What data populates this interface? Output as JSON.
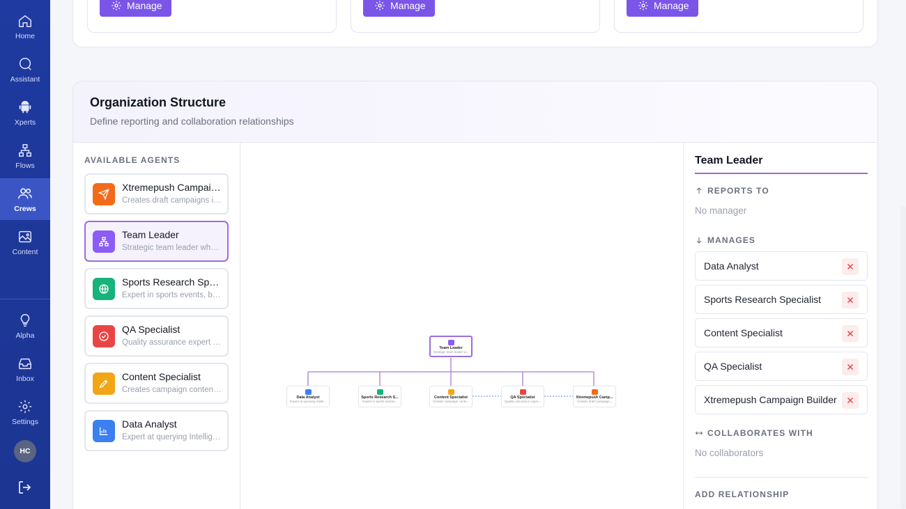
{
  "sidebar": {
    "items": [
      {
        "label": "Home",
        "icon": "home-icon"
      },
      {
        "label": "Assistant",
        "icon": "chat-icon"
      },
      {
        "label": "Xperts",
        "icon": "android-icon"
      },
      {
        "label": "Flows",
        "icon": "flow-icon"
      },
      {
        "label": "Crews",
        "icon": "users-icon",
        "active": true
      },
      {
        "label": "Content",
        "icon": "image-icon"
      }
    ],
    "bottom_items": [
      {
        "label": "Alpha",
        "icon": "lightbulb-icon"
      },
      {
        "label": "Inbox",
        "icon": "inbox-icon"
      },
      {
        "label": "Settings",
        "icon": "gear-icon"
      }
    ],
    "avatar_initials": "HC"
  },
  "top": {
    "manage_label": "Manage"
  },
  "org": {
    "title": "Organization Structure",
    "subtitle": "Define reporting and collaboration relationships",
    "available_agents_label": "AVAILABLE AGENTS",
    "agents": [
      {
        "name": "Xtremepush Campaign Builder",
        "desc": "Creates draft campaigns in Xtremepush",
        "color": "#f46a1b",
        "icon": "send-icon"
      },
      {
        "name": "Team Leader",
        "desc": "Strategic team leader who coordinates the crew",
        "color": "#8b5cf6",
        "icon": "hierarchy-icon",
        "selected": true
      },
      {
        "name": "Sports Research Specialist",
        "desc": "Expert in sports events, bettings and schedules",
        "color": "#16b37a",
        "icon": "globe-icon"
      },
      {
        "name": "QA Specialist",
        "desc": "Quality assurance expert for campaigns",
        "color": "#ea4545",
        "icon": "check-circle-icon"
      },
      {
        "name": "Content Specialist",
        "desc": "Creates campaign content and copy",
        "color": "#f2a516",
        "icon": "pen-icon"
      },
      {
        "name": "Data Analyst",
        "desc": "Expert at querying Intelligence data",
        "color": "#3b7ff0",
        "icon": "chart-icon"
      }
    ],
    "chart": {
      "root": {
        "name": "Team Leader",
        "desc": "Strategic team leader w...",
        "color": "#8b5cf6"
      },
      "children": [
        {
          "name": "Data Analyst",
          "desc": "Expert at querying Intelli...",
          "color": "#3b7ff0"
        },
        {
          "name": "Sports Research S...",
          "desc": "Expert in sports events...",
          "color": "#16b37a"
        },
        {
          "name": "Content Specialist",
          "desc": "Creates campaign conte...",
          "color": "#f2a516"
        },
        {
          "name": "QA Specialist",
          "desc": "Quality assurance exper...",
          "color": "#ea4545"
        },
        {
          "name": "Xtremepush Camp...",
          "desc": "Creates draft campaign...",
          "color": "#f46a1b"
        }
      ]
    },
    "detail": {
      "title": "Team Leader",
      "reports_to_label": "REPORTS TO",
      "reports_to_value": "No manager",
      "manages_label": "MANAGES",
      "manages": [
        "Data Analyst",
        "Sports Research Specialist",
        "Content Specialist",
        "QA Specialist",
        "Xtremepush Campaign Builder"
      ],
      "collaborates_label": "COLLABORATES WITH",
      "collaborates_value": "No collaborators",
      "add_relationship_label": "ADD RELATIONSHIP"
    }
  }
}
